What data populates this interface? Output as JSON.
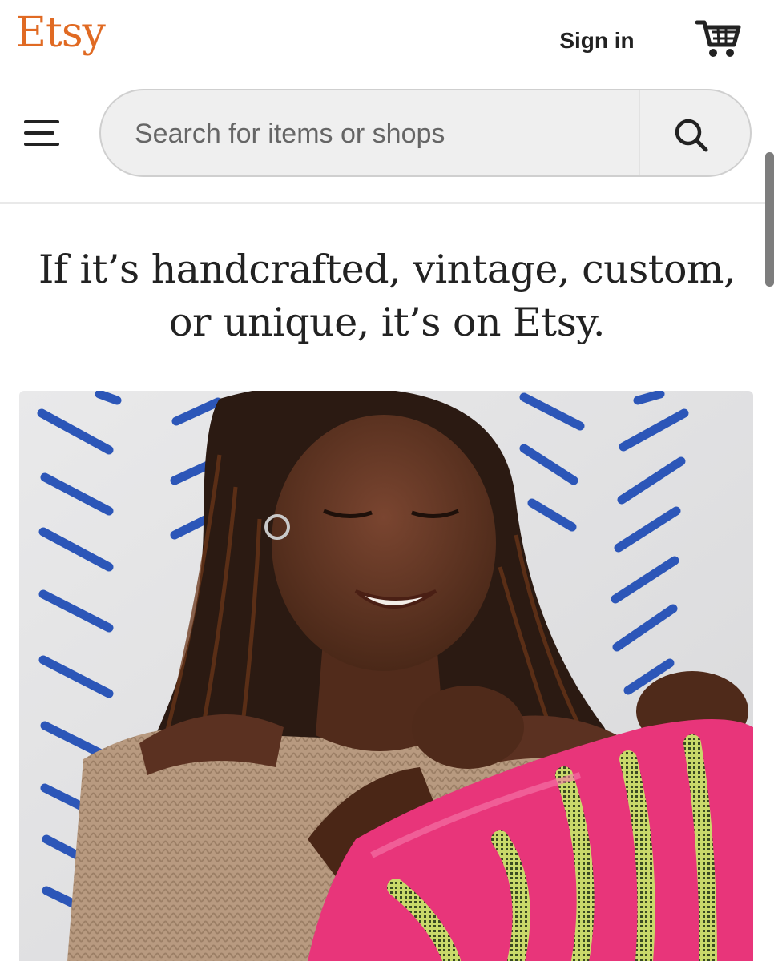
{
  "header": {
    "logo_text": "Etsy",
    "signin_label": "Sign in",
    "cart_icon": "shopping-cart-icon",
    "menu_icon": "hamburger-menu-icon"
  },
  "search": {
    "placeholder": "Search for items or shops",
    "value": "",
    "icon": "search-icon"
  },
  "hero": {
    "headline_line1": "If it’s handcrafted, vintage, custom,",
    "headline_line2": "or unique, it’s on Etsy.",
    "image_subject": "Smiling woman holding pink patterned fabric"
  },
  "colors": {
    "brand": "#e06a23",
    "text": "#222222",
    "search_bg": "#efefef",
    "fabric_pink": "#e8357a",
    "wall_stripes": "#2c56b8"
  }
}
